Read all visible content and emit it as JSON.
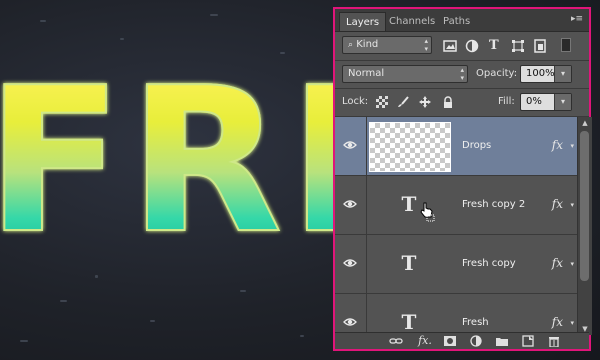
{
  "canvas": {
    "artwork_text": "FRE"
  },
  "layers_panel": {
    "tabs": [
      {
        "label": "Layers",
        "active": true
      },
      {
        "label": "Channels",
        "active": false
      },
      {
        "label": "Paths",
        "active": false
      }
    ],
    "filter": {
      "kind_label": "Kind",
      "filter_icons": [
        "image-filter-icon",
        "adjustment-filter-icon",
        "type-filter-icon",
        "shape-filter-icon",
        "smart-object-filter-icon"
      ]
    },
    "blend_mode": "Normal",
    "opacity_label": "Opacity:",
    "opacity_value": "100%",
    "lock_label": "Lock:",
    "fill_label": "Fill:",
    "fill_value": "0%",
    "layers": [
      {
        "name": "Drops",
        "type": "pixel",
        "selected": true,
        "fx": "fx"
      },
      {
        "name": "Fresh copy 2",
        "type": "text",
        "selected": false,
        "fx": "fx"
      },
      {
        "name": "Fresh copy",
        "type": "text",
        "selected": false,
        "fx": "fx"
      },
      {
        "name": "Fresh",
        "type": "text",
        "selected": false,
        "fx": "fx"
      }
    ],
    "type_glyph": "T",
    "bottom_icons": [
      "link-layers-icon",
      "fx-icon",
      "mask-icon",
      "adjustment-layer-icon",
      "group-folder-icon",
      "new-layer-icon",
      "trash-icon"
    ],
    "bottom_fx_label": "fx.",
    "accent_color": "#e0157a",
    "selected_row_color": "#6f7f9a"
  }
}
